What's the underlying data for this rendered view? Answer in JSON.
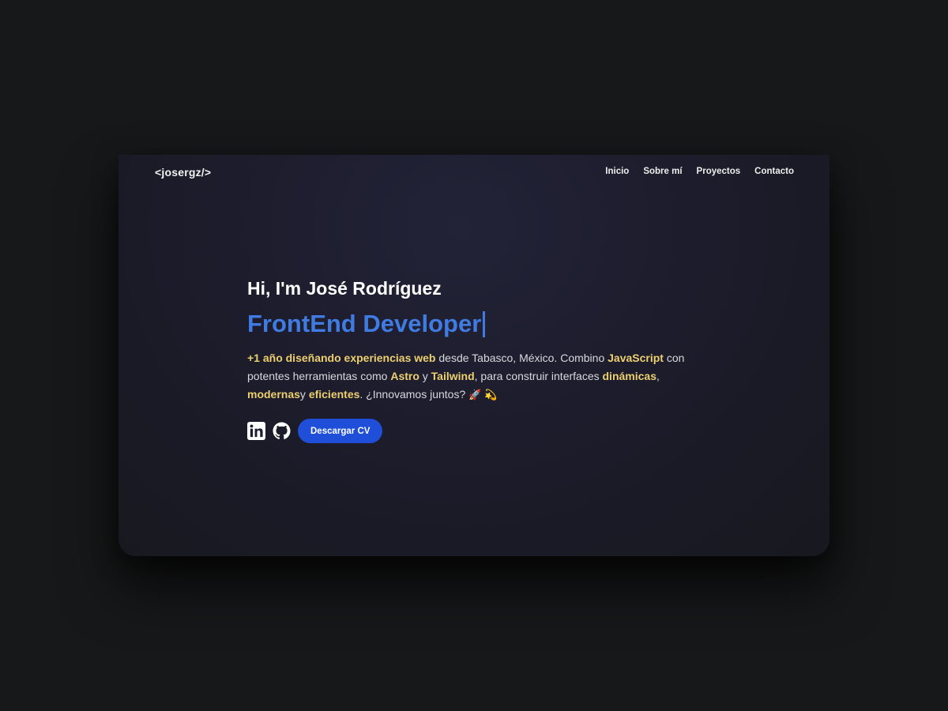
{
  "nav": {
    "logo": "<josergz/>",
    "items": [
      {
        "label": "Inicio"
      },
      {
        "label": "Sobre mí"
      },
      {
        "label": "Proyectos"
      },
      {
        "label": "Contacto"
      }
    ]
  },
  "hero": {
    "greeting": "Hi, I'm José Rodríguez",
    "role": "FrontEnd Developer",
    "description": {
      "p1_hl": "+1 año diseñando experiencias web",
      "p2": " desde Tabasco, México. Combino ",
      "p3_hl": "JavaScript",
      "p4": " con potentes herramientas como ",
      "p5_hl": "Astro",
      "p6": " y ",
      "p7_hl": "Tailwind",
      "p8": ", para construir interfaces ",
      "p9_hl": "dinámicas",
      "p10": ", ",
      "p11_hl": "modernas",
      "p12": "y ",
      "p13_hl": "eficientes",
      "p14": ". ¿Innovamos juntos? ",
      "emoji1": "🚀",
      "emoji2": "💫"
    },
    "actions": {
      "linkedin_icon": "linkedin-icon",
      "github_icon": "github-icon",
      "cv_label": "Descargar CV"
    }
  },
  "colors": {
    "accent_blue": "#3f7be0",
    "button_blue": "#1f4fd8",
    "highlight_yellow": "#ecd06f",
    "page_bg": "#171819"
  }
}
